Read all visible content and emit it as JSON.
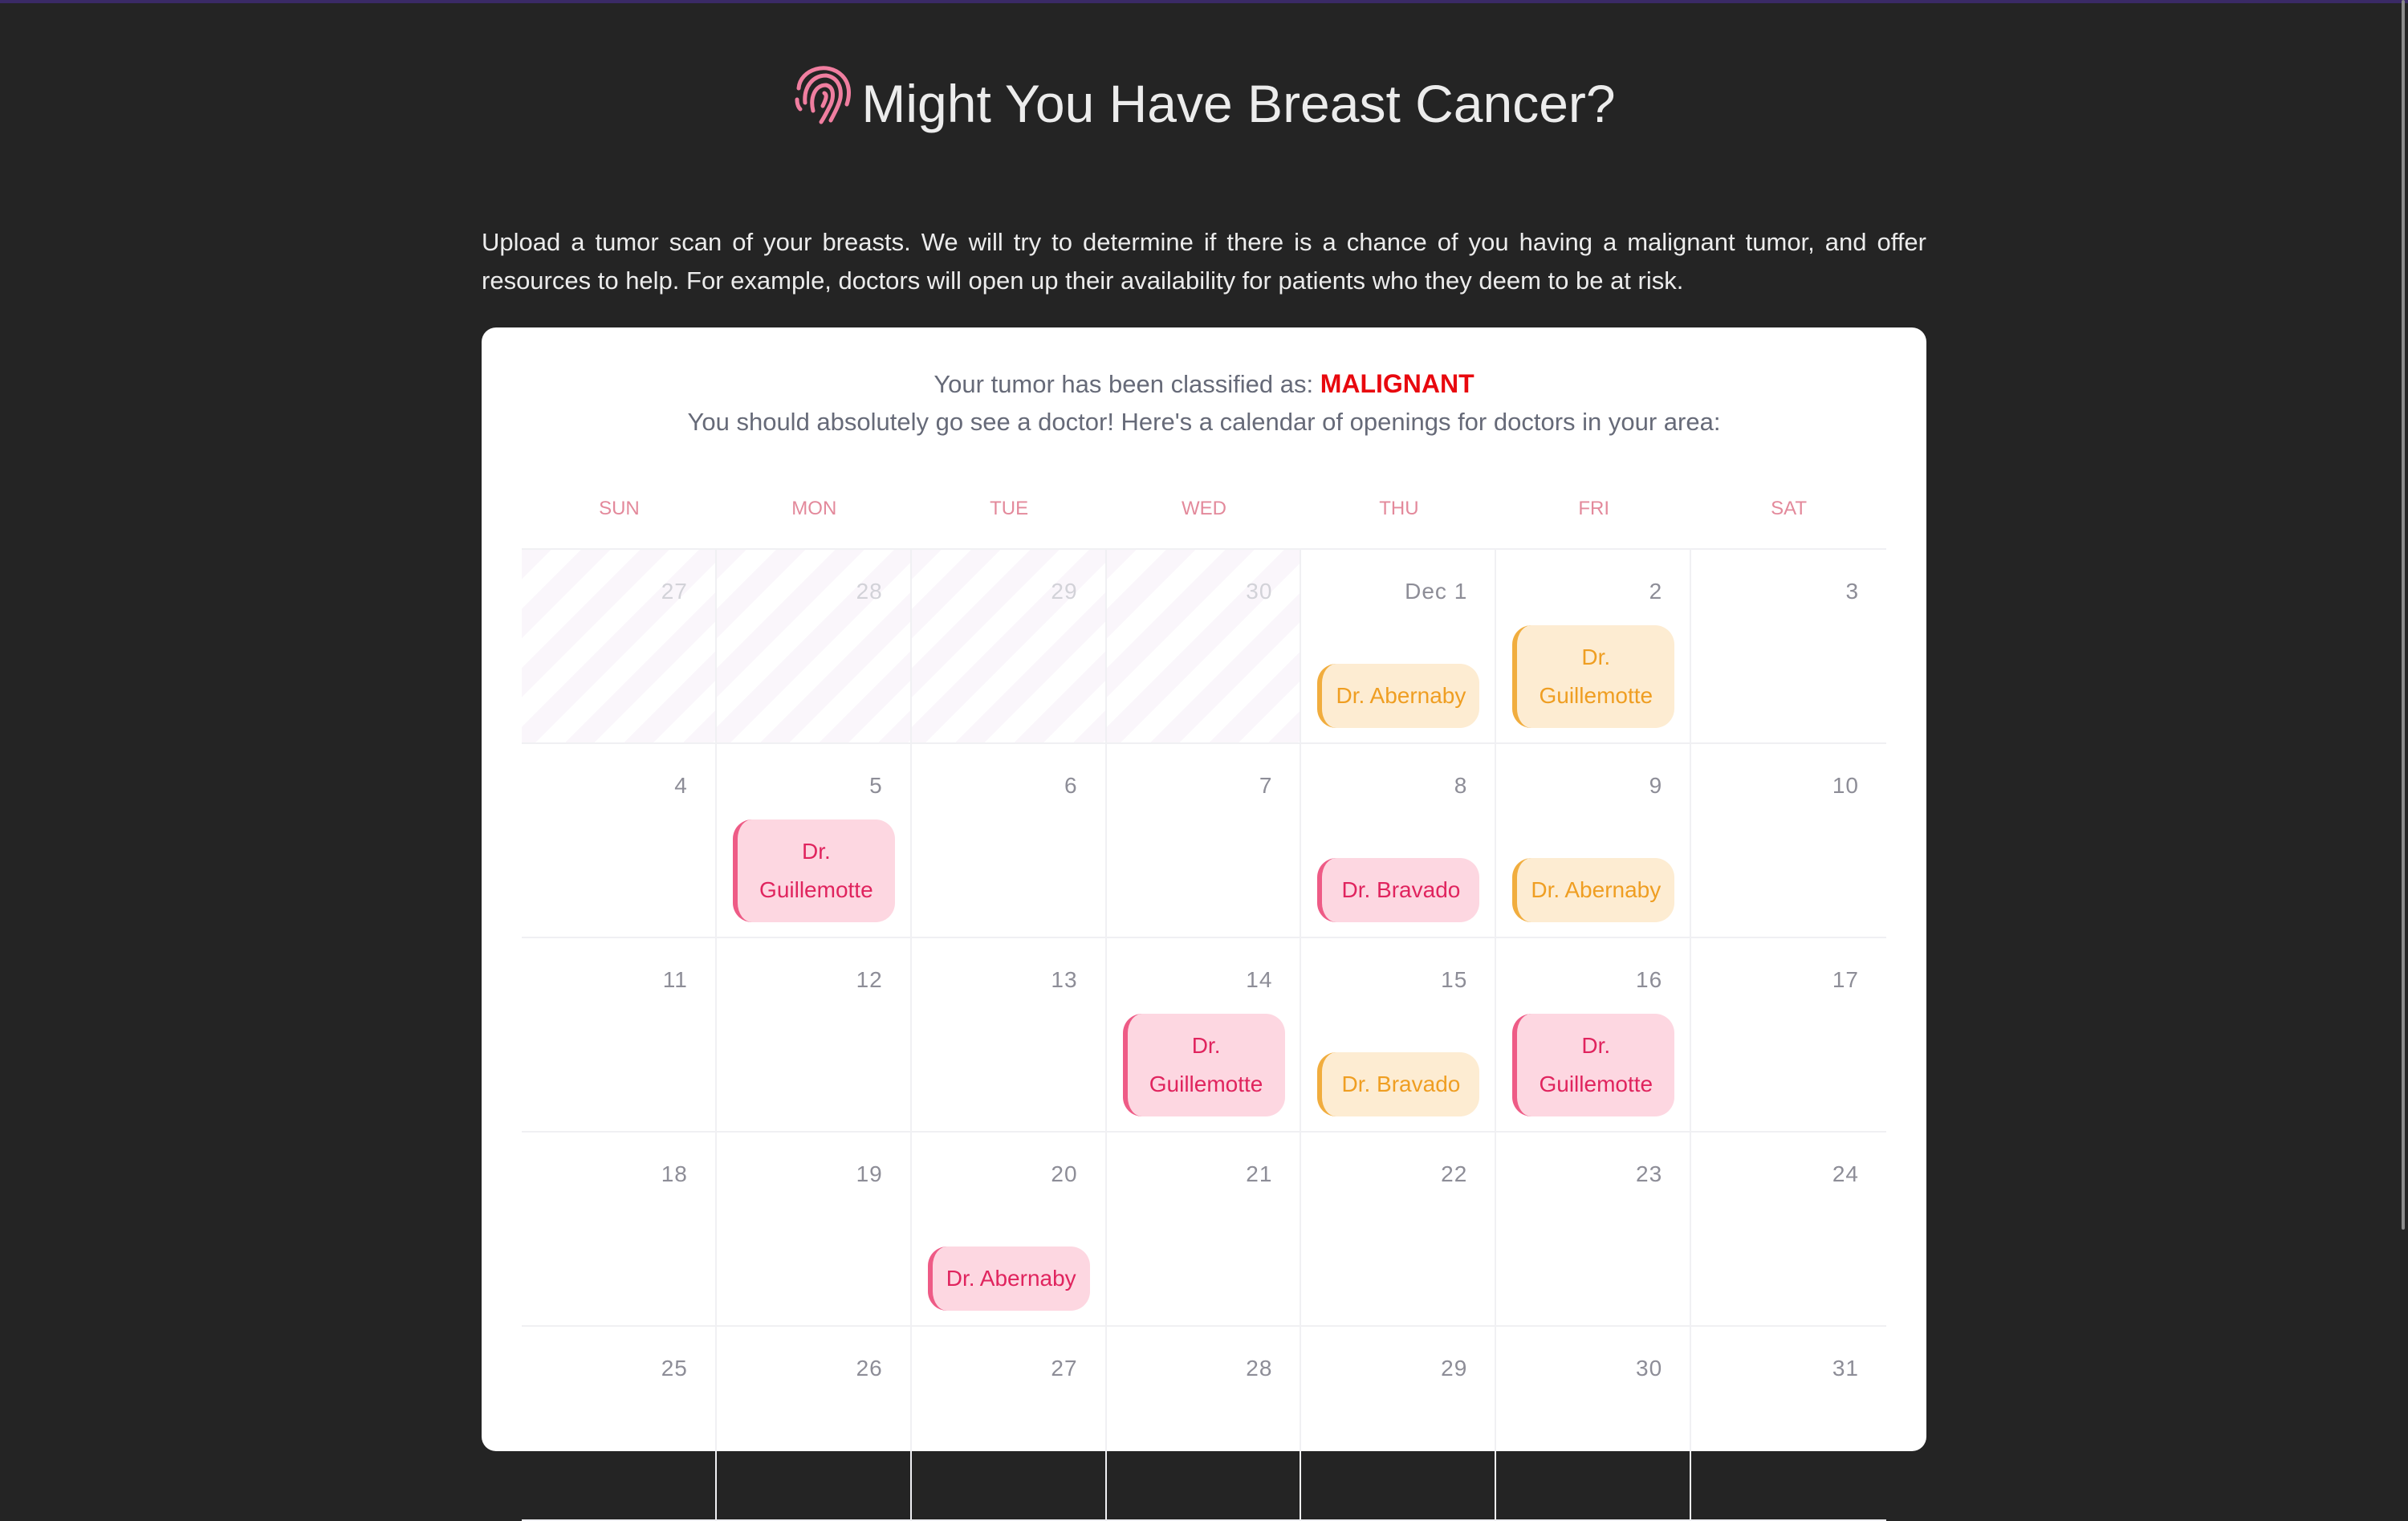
{
  "title": "Might You Have Breast Cancer?",
  "icon": "fingerprint-icon",
  "intro": "Upload a tumor scan of your breasts. We will try to determine if there is a chance of you having a malignant tumor, and offer resources to help. For example, doctors will open up their availability for patients who they deem to be at risk.",
  "result": {
    "prefix": "Your tumor has been classified as: ",
    "classification": "MALIGNANT",
    "advice": "You should absolutely go see a doctor! Here's a calendar of openings for doctors in your area:"
  },
  "colors": {
    "malignant": "#e8080e",
    "appt_pink": "#fdd7e1",
    "appt_orange": "#fdecd2"
  },
  "calendar": {
    "weekdays": [
      "SUN",
      "MON",
      "TUE",
      "WED",
      "THU",
      "FRI",
      "SAT"
    ],
    "weeks": [
      [
        {
          "label": "27",
          "past": true
        },
        {
          "label": "28",
          "past": true
        },
        {
          "label": "29",
          "past": true
        },
        {
          "label": "30",
          "past": true
        },
        {
          "label": "Dec 1",
          "appt": {
            "text": "Dr. Abernaby",
            "color": "orange"
          }
        },
        {
          "label": "2",
          "appt": {
            "text": "Dr. Guillemotte",
            "color": "orange"
          }
        },
        {
          "label": "3"
        }
      ],
      [
        {
          "label": "4"
        },
        {
          "label": "5",
          "appt": {
            "text": "Dr. Guillemotte",
            "color": "pink"
          }
        },
        {
          "label": "6"
        },
        {
          "label": "7"
        },
        {
          "label": "8",
          "appt": {
            "text": "Dr. Bravado",
            "color": "pink"
          }
        },
        {
          "label": "9",
          "appt": {
            "text": "Dr. Abernaby",
            "color": "orange"
          }
        },
        {
          "label": "10"
        }
      ],
      [
        {
          "label": "11"
        },
        {
          "label": "12"
        },
        {
          "label": "13"
        },
        {
          "label": "14",
          "appt": {
            "text": "Dr. Guillemotte",
            "color": "pink"
          }
        },
        {
          "label": "15",
          "appt": {
            "text": "Dr. Bravado",
            "color": "orange"
          }
        },
        {
          "label": "16",
          "appt": {
            "text": "Dr. Guillemotte",
            "color": "pink"
          }
        },
        {
          "label": "17"
        }
      ],
      [
        {
          "label": "18"
        },
        {
          "label": "19"
        },
        {
          "label": "20",
          "appt": {
            "text": "Dr. Abernaby",
            "color": "pink"
          }
        },
        {
          "label": "21"
        },
        {
          "label": "22"
        },
        {
          "label": "23"
        },
        {
          "label": "24"
        }
      ],
      [
        {
          "label": "25"
        },
        {
          "label": "26"
        },
        {
          "label": "27"
        },
        {
          "label": "28"
        },
        {
          "label": "29"
        },
        {
          "label": "30"
        },
        {
          "label": "31"
        }
      ]
    ]
  }
}
